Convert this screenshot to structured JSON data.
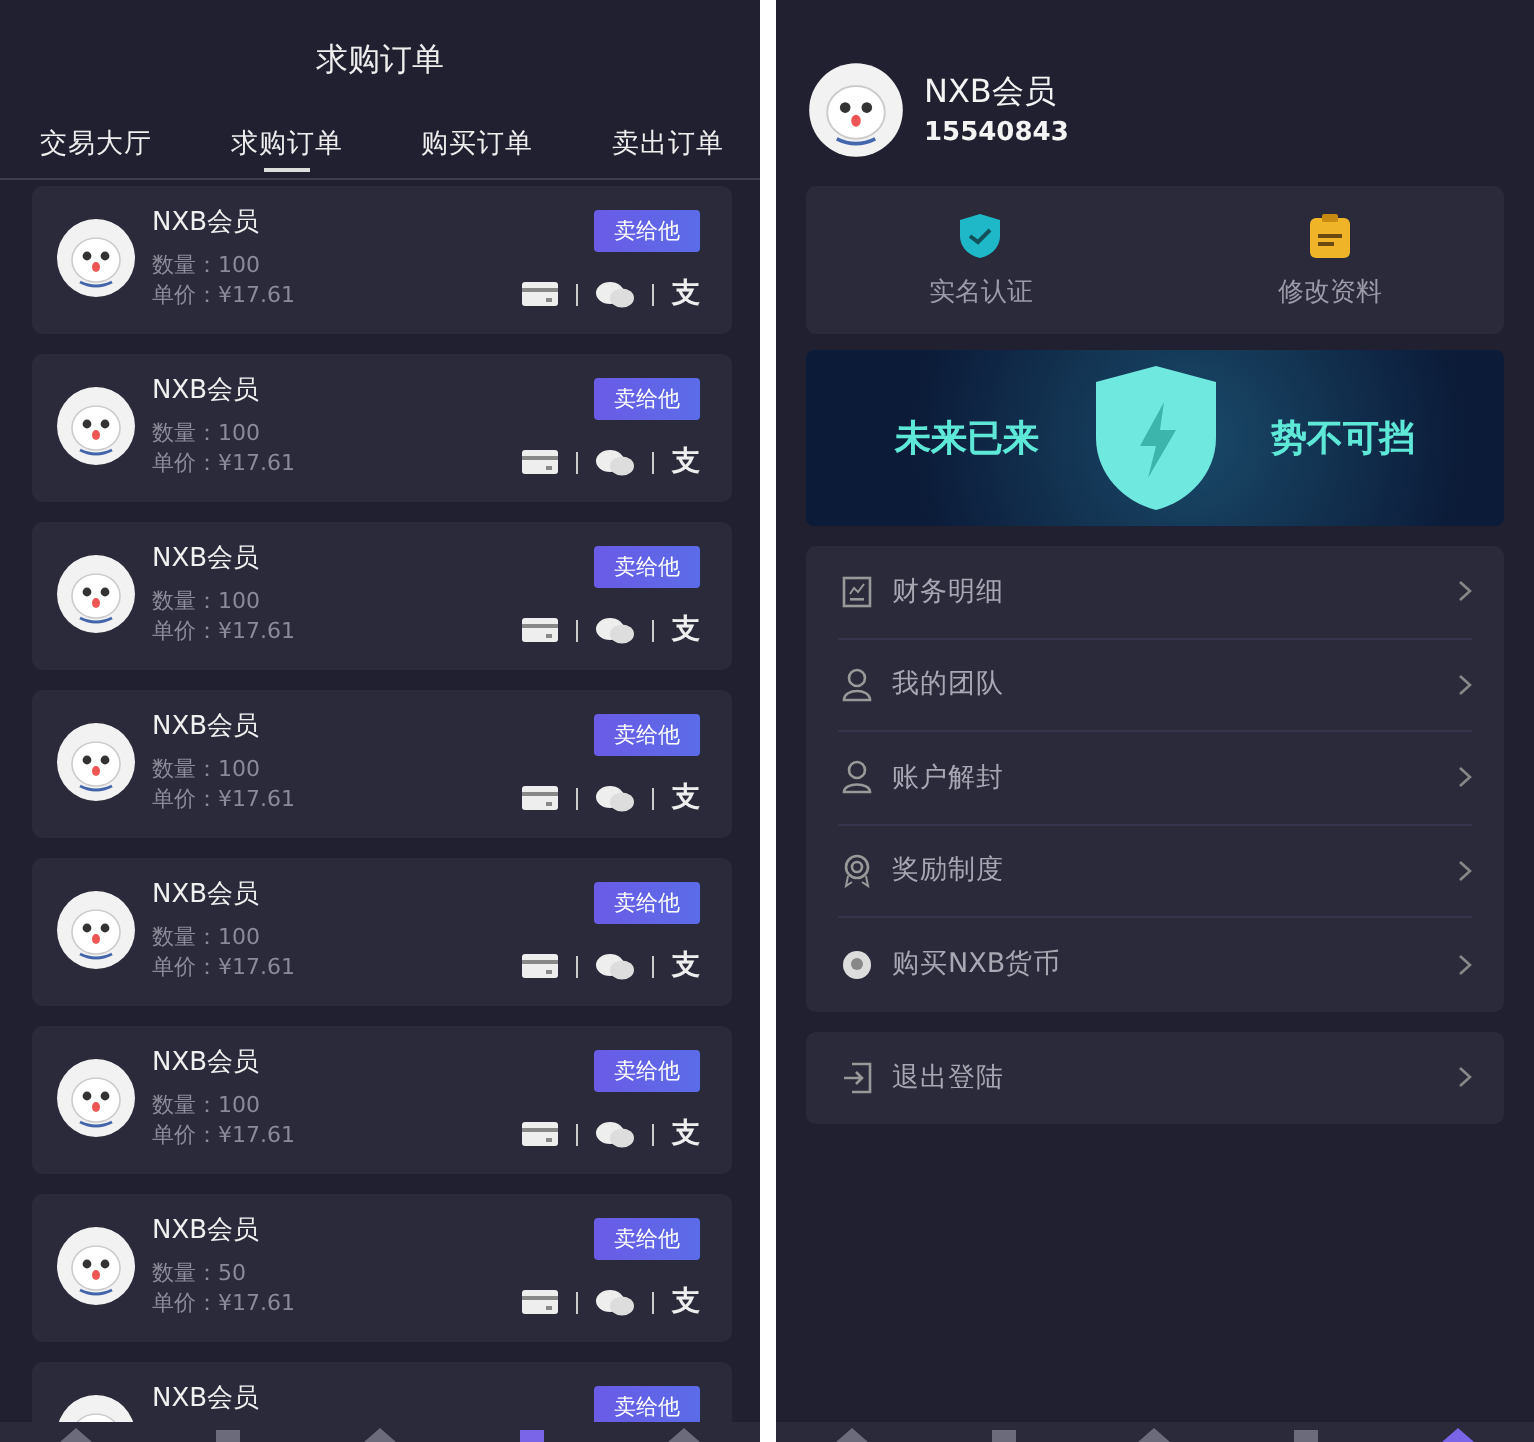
{
  "left": {
    "title": "求购订单",
    "tabs": [
      {
        "label": "交易大厅",
        "selected": false
      },
      {
        "label": "求购订单",
        "selected": true
      },
      {
        "label": "购买订单",
        "selected": false
      },
      {
        "label": "卖出订单",
        "selected": false
      }
    ],
    "orders": [
      {
        "name": "NXB会员",
        "quantity": "数量：100",
        "price": "单价：¥17.61",
        "action": "卖给他",
        "alipay_glyph": "支"
      },
      {
        "name": "NXB会员",
        "quantity": "数量：100",
        "price": "单价：¥17.61",
        "action": "卖给他",
        "alipay_glyph": "支"
      },
      {
        "name": "NXB会员",
        "quantity": "数量：100",
        "price": "单价：¥17.61",
        "action": "卖给他",
        "alipay_glyph": "支"
      },
      {
        "name": "NXB会员",
        "quantity": "数量：100",
        "price": "单价：¥17.61",
        "action": "卖给他",
        "alipay_glyph": "支"
      },
      {
        "name": "NXB会员",
        "quantity": "数量：100",
        "price": "单价：¥17.61",
        "action": "卖给他",
        "alipay_glyph": "支"
      },
      {
        "name": "NXB会员",
        "quantity": "数量：100",
        "price": "单价：¥17.61",
        "action": "卖给他",
        "alipay_glyph": "支"
      },
      {
        "name": "NXB会员",
        "quantity": "数量：50",
        "price": "单价：¥17.61",
        "action": "卖给他",
        "alipay_glyph": "支"
      },
      {
        "name": "NXB会员",
        "action": "卖给他"
      }
    ],
    "bottom_nav": [
      {
        "selected": false
      },
      {
        "selected": false
      },
      {
        "selected": false
      },
      {
        "selected": true
      },
      {
        "selected": false
      }
    ]
  },
  "right": {
    "user": {
      "name": "NXB会员",
      "phone": "15540843"
    },
    "quick_actions": [
      {
        "kind": "verify",
        "label": "实名认证"
      },
      {
        "kind": "edit",
        "label": "修改资料"
      }
    ],
    "banner": {
      "left_text": "未来已来",
      "right_text": "势不可挡"
    },
    "menu": [
      {
        "kind": "finance",
        "label": "财务明细"
      },
      {
        "kind": "team",
        "label": "我的团队"
      },
      {
        "kind": "unlock",
        "label": "账户解封"
      },
      {
        "kind": "reward",
        "label": "奖励制度"
      },
      {
        "kind": "coin",
        "label": "购买NXB货币"
      }
    ],
    "logout": {
      "label": "退出登陆"
    },
    "bottom_nav": [
      {
        "selected": false
      },
      {
        "selected": false
      },
      {
        "selected": false
      },
      {
        "selected": false
      },
      {
        "selected": true
      }
    ]
  }
}
